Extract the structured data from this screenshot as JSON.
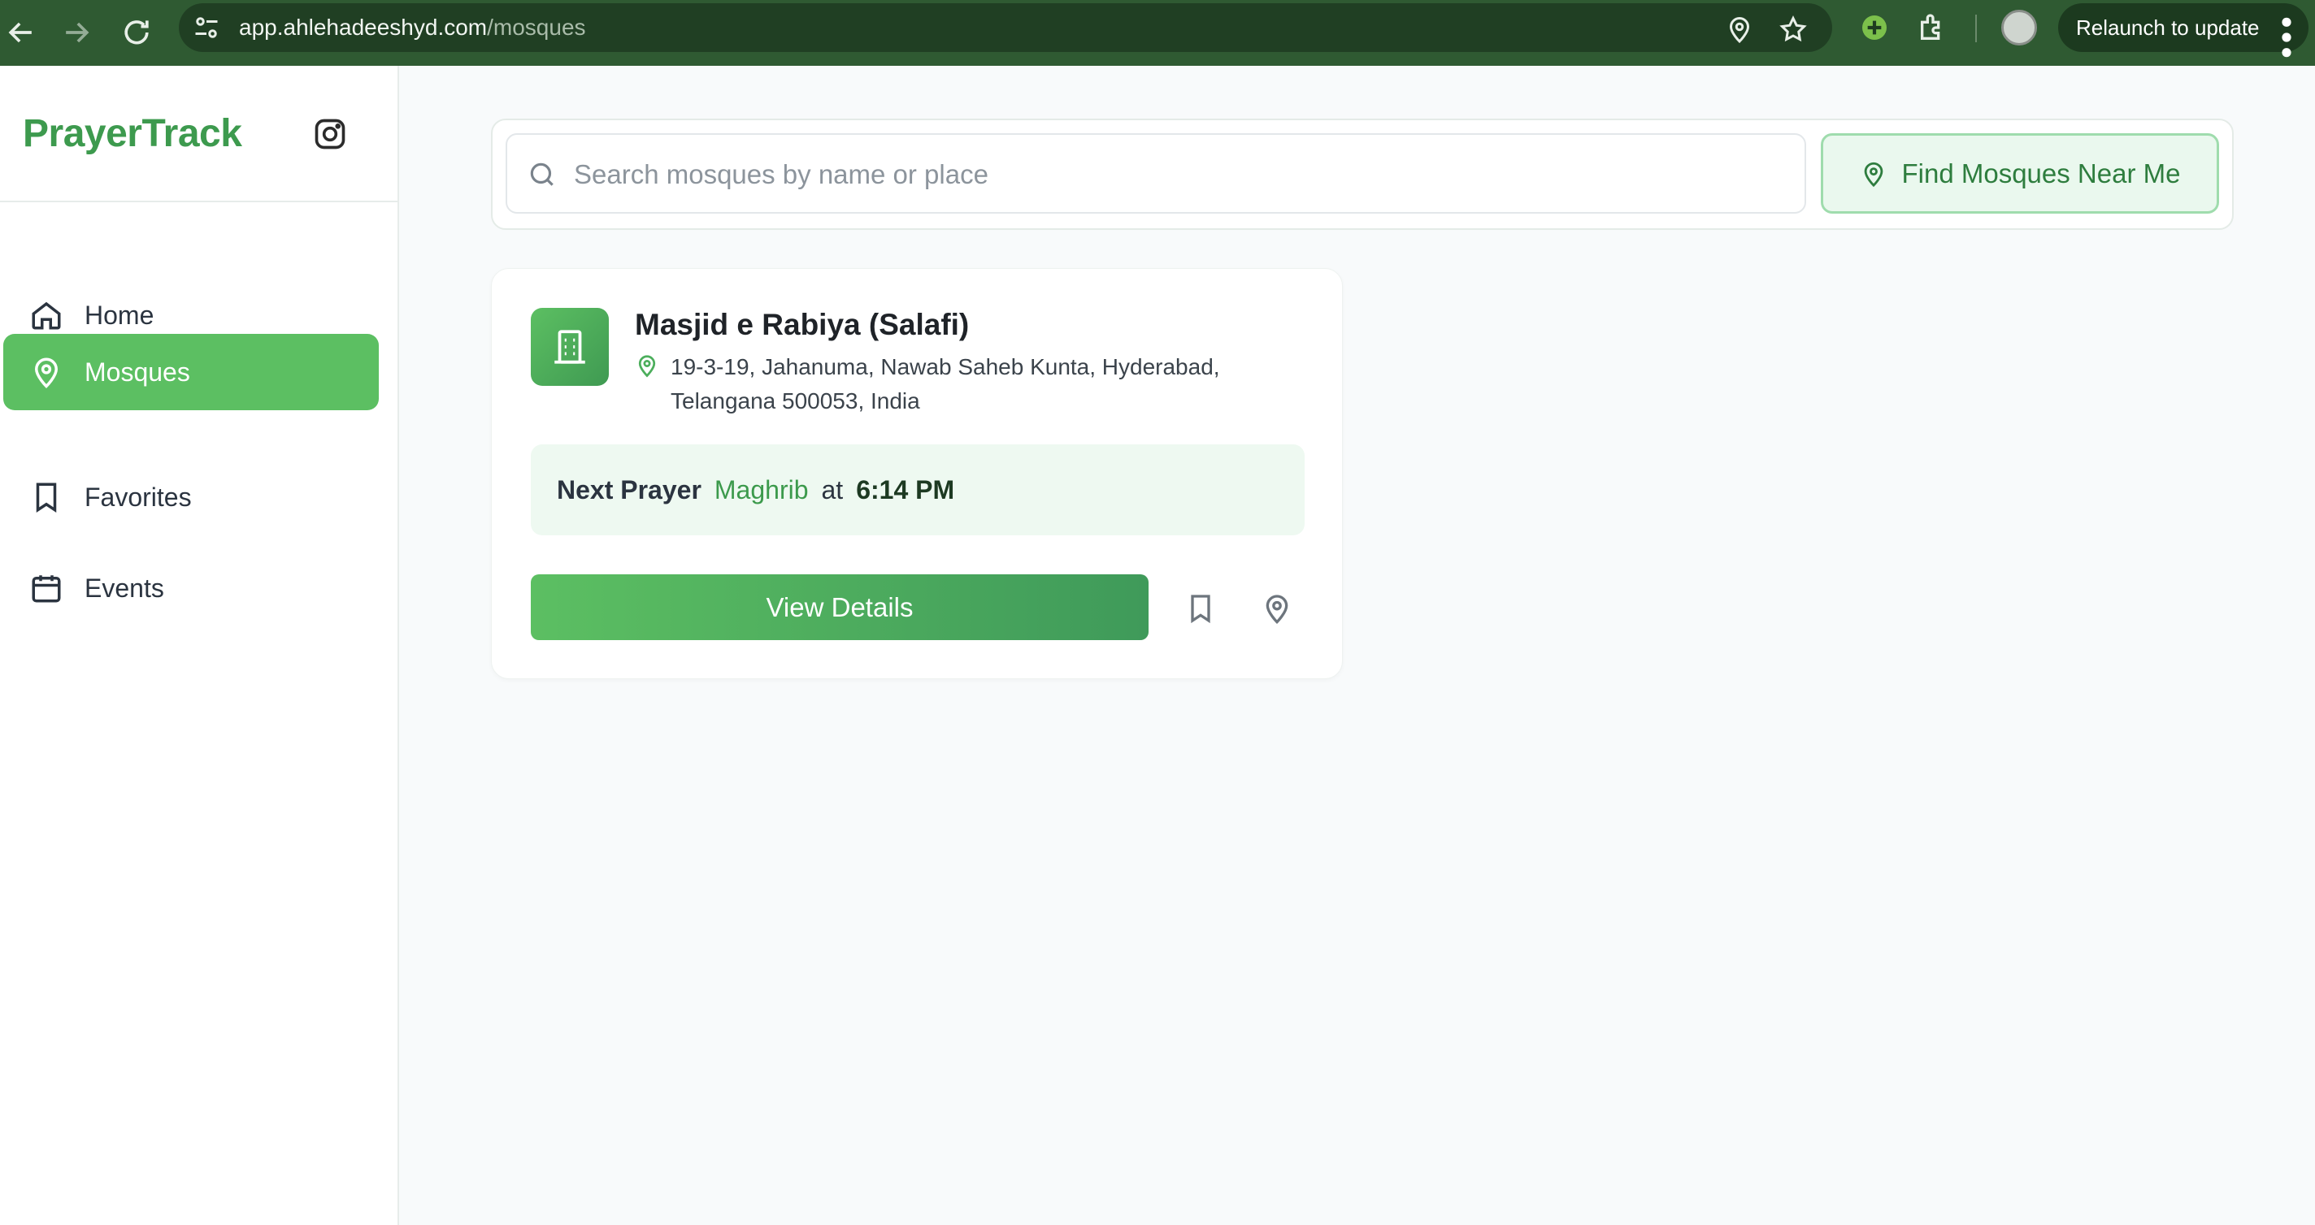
{
  "browser": {
    "url_domain": "app.ahlehadeeshyd.com",
    "url_path": "/mosques",
    "relaunch_label": "Relaunch to update"
  },
  "sidebar": {
    "brand": "PrayerTrack",
    "items": [
      {
        "label": "Home",
        "icon": "home-icon",
        "active": false
      },
      {
        "label": "Mosques",
        "icon": "map-pin-icon",
        "active": true
      },
      {
        "label": "Favorites",
        "icon": "bookmark-icon",
        "active": false
      },
      {
        "label": "Events",
        "icon": "calendar-icon",
        "active": false
      }
    ]
  },
  "search": {
    "placeholder": "Search mosques by name or place",
    "near_me_label": "Find Mosques Near Me"
  },
  "mosques": [
    {
      "name": "Masjid e Rabiya (Salafi)",
      "address": "19-3-19, Jahanuma, Nawab Saheb Kunta, Hyderabad, Telangana 500053, India",
      "next_prayer_label": "Next Prayer",
      "next_prayer_name": "Maghrib",
      "next_prayer_at": "at",
      "next_prayer_time": "6:14 PM",
      "view_details_label": "View Details"
    }
  ],
  "colors": {
    "brand_green": "#3d9a4e",
    "active_nav": "#5cbf62",
    "chrome_bg": "#2f5a32"
  }
}
